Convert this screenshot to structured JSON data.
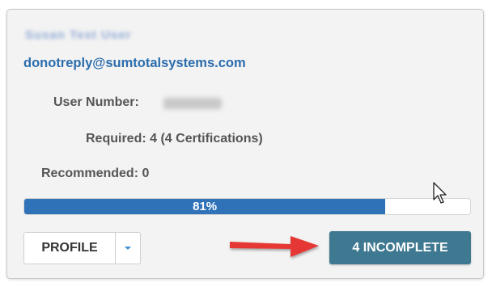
{
  "user": {
    "name": "Susan Test User",
    "email": "donotreply@sumtotalsystems.com",
    "user_number_label": "User Number:",
    "user_number_value": "0000000"
  },
  "requirements": {
    "required_label": "Required: 4 (4 Certifications)",
    "recommended_label": "Recommended: 0"
  },
  "progress": {
    "percent": 81,
    "label": "81%"
  },
  "actions": {
    "profile_label": "PROFILE",
    "incomplete_label": "4 INCOMPLETE"
  },
  "colors": {
    "accent": "#2f72b8",
    "incomplete_button": "#3f7891",
    "email_link": "#2b6dad",
    "annotation_arrow": "#e53935"
  },
  "icons": {
    "caret": "chevron-down-icon",
    "annotation": "red-arrow-icon",
    "pointer": "mouse-cursor-icon"
  }
}
